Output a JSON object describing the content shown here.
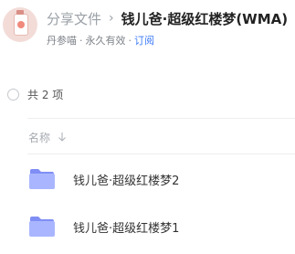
{
  "header": {
    "breadcrumb": "分享文件",
    "separator": "›",
    "title": "钱儿爸·超级红楼梦(WMA)",
    "author": "丹参喵",
    "validity": "永久有效",
    "subscribe": "订阅",
    "dot": "·"
  },
  "list": {
    "count_text": "共 2 项",
    "column_name": "名称",
    "items": [
      {
        "name": "钱儿爸·超级红楼梦2",
        "icon": "folder-icon"
      },
      {
        "name": "钱儿爸·超级红楼梦1",
        "icon": "folder-icon"
      }
    ]
  },
  "colors": {
    "link": "#3f7cf6",
    "folder_light": "#a9b6ff",
    "folder_dark": "#7f8ef5"
  }
}
